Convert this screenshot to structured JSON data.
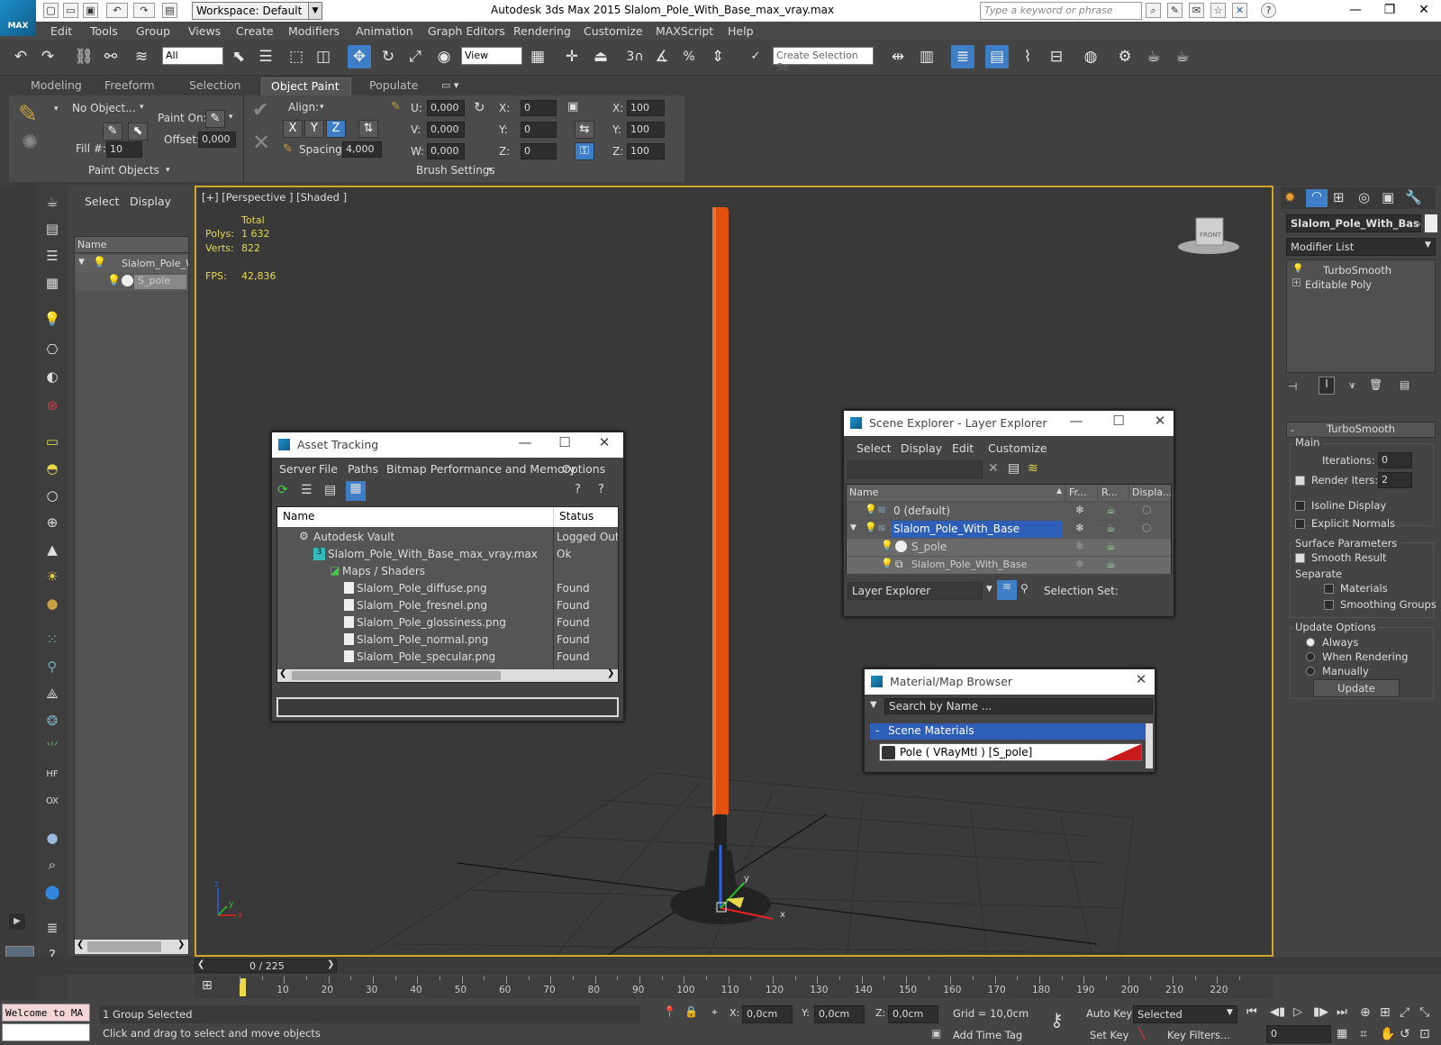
{
  "titlebar": {
    "logo_label": "MAX",
    "workspace_label": "Workspace: Default",
    "app_title": "Autodesk 3ds Max  2015    Slalom_Pole_With_Base_max_vray.max",
    "search_placeholder": "Type a keyword or phrase"
  },
  "menu": [
    "Edit",
    "Tools",
    "Group",
    "Views",
    "Create",
    "Modifiers",
    "Animation",
    "Graph Editors",
    "Rendering",
    "Customize",
    "MAXScript",
    "Help"
  ],
  "maintoolbar": {
    "filter": "All",
    "refcoord": "View",
    "selection_set_placeholder": "Create Selection Se"
  },
  "ribbon": {
    "tabs": [
      "Modeling",
      "Freeform",
      "Selection",
      "Object Paint",
      "Populate"
    ],
    "active_tab": "Object Paint",
    "no_object": "No Object...",
    "paint_on": "Paint On:",
    "offset_label": "Offset:",
    "offset_value": "0,000",
    "fill_label": "Fill #:",
    "fill_value": "10",
    "align_label": "Align:",
    "axis_x": "X",
    "axis_y": "Y",
    "axis_z": "Z",
    "spacing_label": "Spacing:",
    "spacing_value": "4,000",
    "u_label": "U:",
    "u_value": "0,000",
    "v_label": "V:",
    "v_value": "0,000",
    "w_label": "W:",
    "w_value": "0,000",
    "rx_label": "X:",
    "rx_value": "0",
    "ry_label": "Y:",
    "ry_value": "0",
    "rz_label": "Z:",
    "rz_value": "0",
    "sx_label": "X:",
    "sx_value": "100",
    "sy_label": "Y:",
    "sy_value": "100",
    "sz_label": "Z:",
    "sz_value": "100",
    "paint_objects": "Paint Objects",
    "brush_settings": "Brush Settings"
  },
  "scene_panel": {
    "tabs": [
      "Select",
      "Display"
    ],
    "column": "Name",
    "items": [
      {
        "label": "Slalom_Pole_W"
      },
      {
        "label": "S_pole"
      }
    ]
  },
  "viewport": {
    "label": "[+] [Perspective ] [Shaded ]",
    "total": "Total",
    "polys_label": "Polys:",
    "polys_value": "1 632",
    "verts_label": "Verts:",
    "verts_value": "822",
    "fps_label": "FPS:",
    "fps_value": "42,836",
    "viewcube_text": "FRONT",
    "gizmo_x": "x",
    "gizmo_y": "y",
    "axis_x": "x",
    "axis_y": "y",
    "axis_z": "z"
  },
  "command_panel": {
    "object_name": "Slalom_Pole_With_Base",
    "modifier_list": "Modifier List",
    "stack": [
      "TurboSmooth",
      "Editable Poly"
    ],
    "rollout_title": "TurboSmooth",
    "main_label": "Main",
    "iterations_label": "Iterations:",
    "iterations_value": "0",
    "render_iters_label": "Render Iters:",
    "render_iters_value": "2",
    "isoline": "Isoline Display",
    "explicit_normals": "Explicit Normals",
    "surface_params": "Surface Parameters",
    "smooth_result": "Smooth Result",
    "separate": "Separate",
    "materials": "Materials",
    "smoothing_groups": "Smoothing Groups",
    "update_options": "Update Options",
    "always": "Always",
    "when_rendering": "When Rendering",
    "manually": "Manually",
    "update_button": "Update",
    "collapse_glyph": "-"
  },
  "asset_tracking": {
    "title": "Asset Tracking",
    "menu": [
      "Server",
      "File",
      "Paths",
      "Bitmap Performance and Memory",
      "Options"
    ],
    "col_name": "Name",
    "col_status": "Status",
    "rows": [
      {
        "name": "Autodesk Vault",
        "status": "Logged Out ."
      },
      {
        "name": "Slalom_Pole_With_Base_max_vray.max",
        "status": "Ok"
      },
      {
        "name": "Maps / Shaders",
        "status": ""
      },
      {
        "name": "Slalom_Pole_diffuse.png",
        "status": "Found"
      },
      {
        "name": "Slalom_Pole_fresnel.png",
        "status": "Found"
      },
      {
        "name": "Slalom_Pole_glossiness.png",
        "status": "Found"
      },
      {
        "name": "Slalom_Pole_normal.png",
        "status": "Found"
      },
      {
        "name": "Slalom_Pole_specular.png",
        "status": "Found"
      }
    ]
  },
  "scene_explorer": {
    "title": "Scene Explorer - Layer Explorer",
    "menu": [
      "Select",
      "Display",
      "Edit",
      "Customize"
    ],
    "cols": [
      "Name",
      "Fr...",
      "R...",
      "Displa..."
    ],
    "rows": [
      {
        "name": "0 (default)"
      },
      {
        "name": "Slalom_Pole_With_Base"
      },
      {
        "name": "S_pole"
      },
      {
        "name": "Slalom_Pole_With_Base"
      }
    ],
    "footer_dropdown": "Layer Explorer",
    "selection_set": "Selection Set:"
  },
  "material_browser": {
    "title": "Material/Map Browser",
    "search_placeholder": "Search by Name ...",
    "group": "Scene Materials",
    "group_glyph": "-",
    "material": "Pole  ( VRayMtl )  [S_pole]"
  },
  "timeline": {
    "frame_counter": "0 / 225",
    "ticks": [
      "10",
      "20",
      "30",
      "40",
      "50",
      "60",
      "70",
      "80",
      "90",
      "100",
      "110",
      "120",
      "130",
      "140",
      "150",
      "160",
      "170",
      "180",
      "190",
      "200",
      "210",
      "220"
    ]
  },
  "status": {
    "maxscript": "Welcome to MA",
    "selected": "1 Group Selected",
    "prompt": "Click and drag to select and move objects",
    "x_label": "X:",
    "x_value": "0,0cm",
    "y_label": "Y:",
    "y_value": "0,0cm",
    "z_label": "Z:",
    "z_value": "0,0cm",
    "grid": "Grid = 10,0cm",
    "auto_key": "Auto Key",
    "set_key": "Set Key",
    "selected_dropdown": "Selected",
    "key_filters": "Key Filters...",
    "add_time_tag": "Add Time Tag",
    "frame": "0"
  },
  "colors": {
    "accent_blue": "#3d7ec7",
    "viewport_border": "#d4a52a",
    "pole_orange": "#e4500f",
    "stats_yellow": "#e8d84a"
  }
}
